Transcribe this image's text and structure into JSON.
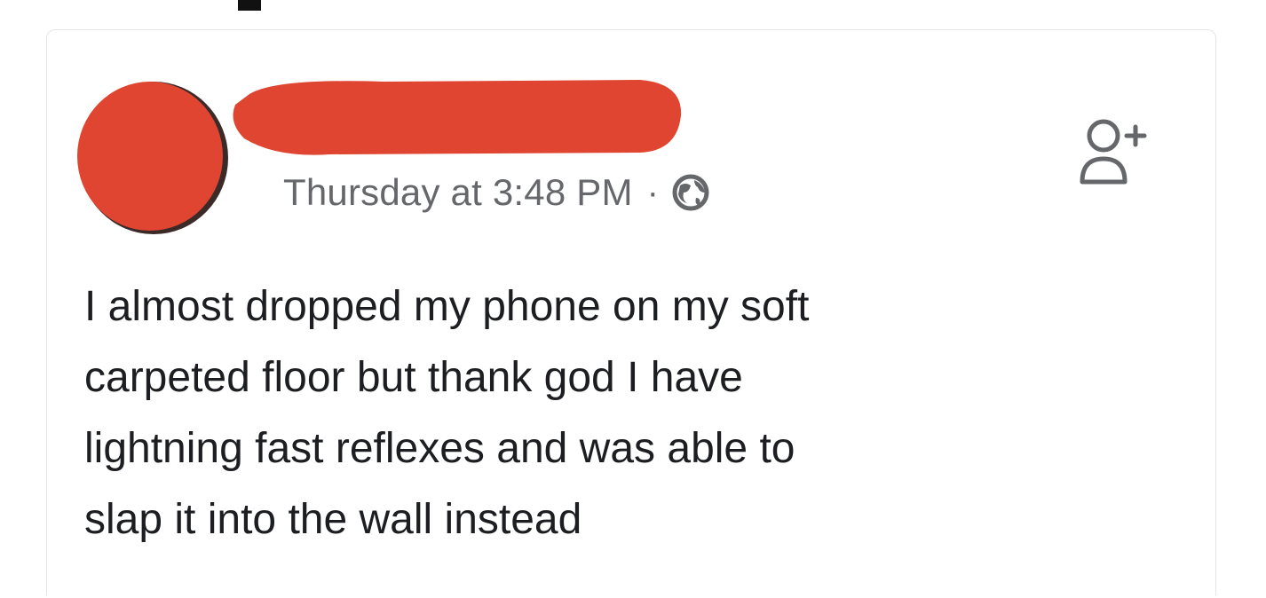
{
  "post": {
    "timestamp": "Thursday at 3:48 PM",
    "separator": "·",
    "audience_icon": "globe-icon",
    "action_icon": "add-friend-icon",
    "text": "I almost dropped my phone on my soft\ncarpeted floor but thank god I have\nlightning fast reflexes and was able to\nslap it into the wall instead"
  },
  "colors": {
    "redaction": "#df4530",
    "meta_text": "#65676b",
    "body_text": "#1c1e21"
  }
}
